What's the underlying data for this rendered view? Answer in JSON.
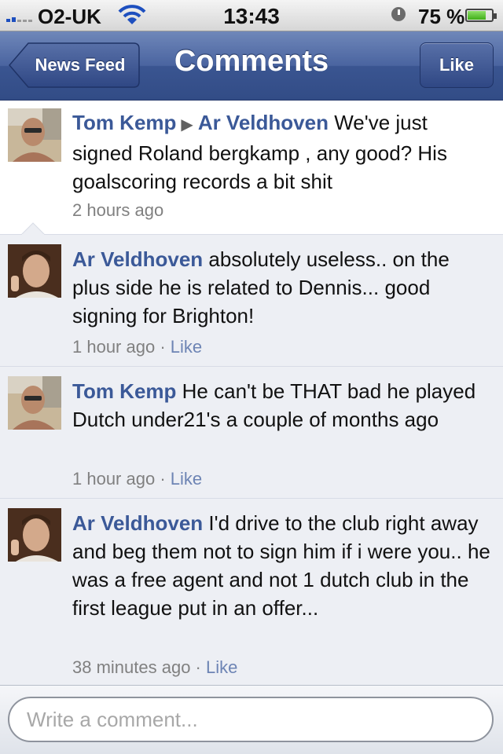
{
  "status_bar": {
    "carrier": "O2-UK",
    "time": "13:43",
    "battery": "75 %",
    "battery_level": 0.75,
    "icons": [
      "signal-icon",
      "wifi-icon",
      "clock-icon",
      "battery-icon"
    ]
  },
  "navbar": {
    "back_label": "News Feed",
    "title": "Comments",
    "like_label": "Like"
  },
  "post": {
    "author": "Tom Kemp",
    "recipient": "Ar Veldhoven",
    "text": "We've just signed Roland bergkamp , any good? His goalscoring records a bit shit",
    "time": "2 hours ago"
  },
  "comments": [
    {
      "author": "Ar Veldhoven",
      "text": "absolutely useless.. on the plus side he is related to Dennis... good signing for Brighton!",
      "time": "1 hour ago",
      "like": "Like"
    },
    {
      "author": "Tom Kemp",
      "text": "He can't be THAT bad he played Dutch under21's a couple of months ago",
      "time": "1 hour ago",
      "like": "Like"
    },
    {
      "author": "Ar Veldhoven",
      "text": "I'd drive to the club right away and beg them not to sign him if i were you.. he was a free agent and not 1 dutch club in the first league put in an offer...",
      "time": "38 minutes ago",
      "like": "Like"
    }
  ],
  "composer": {
    "placeholder": "Write a comment..."
  },
  "colors": {
    "nav": "#3b5998",
    "author": "#3b5998",
    "comment_bg": "#edeff4",
    "like_link": "#6d84b4"
  }
}
